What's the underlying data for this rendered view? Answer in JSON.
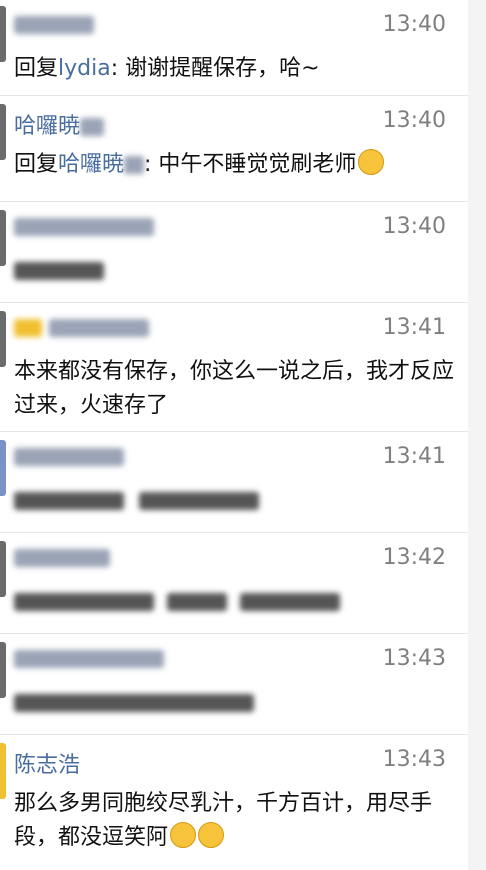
{
  "messages": [
    {
      "name": "",
      "time": "13:40",
      "prefix": "回复",
      "mention": "lydia",
      "text": ": 谢谢提醒保存，哈~"
    },
    {
      "name": "哈囉暁",
      "time": "13:40",
      "prefix": "回复",
      "mention": "哈囉暁",
      "text": ": 中午不睡觉觉刷老师"
    },
    {
      "name": "",
      "time": "13:40",
      "text": ""
    },
    {
      "name": "",
      "time": "13:41",
      "text": "本来都没有保存，你这么一说之后，我才反应过来，火速存了"
    },
    {
      "name": "",
      "time": "13:41",
      "text": ""
    },
    {
      "name": "",
      "time": "13:42",
      "text": ""
    },
    {
      "name": "",
      "time": "13:43",
      "text": ""
    },
    {
      "name": "陈志浩",
      "time": "13:43",
      "text": "那么多男同胞绞尽乳汁，千方百计，用尽手段，都没逗笑阿"
    }
  ],
  "colors": {
    "name": "#4a6da0",
    "time": "#7f7f7f",
    "accent": "#f0c030"
  }
}
